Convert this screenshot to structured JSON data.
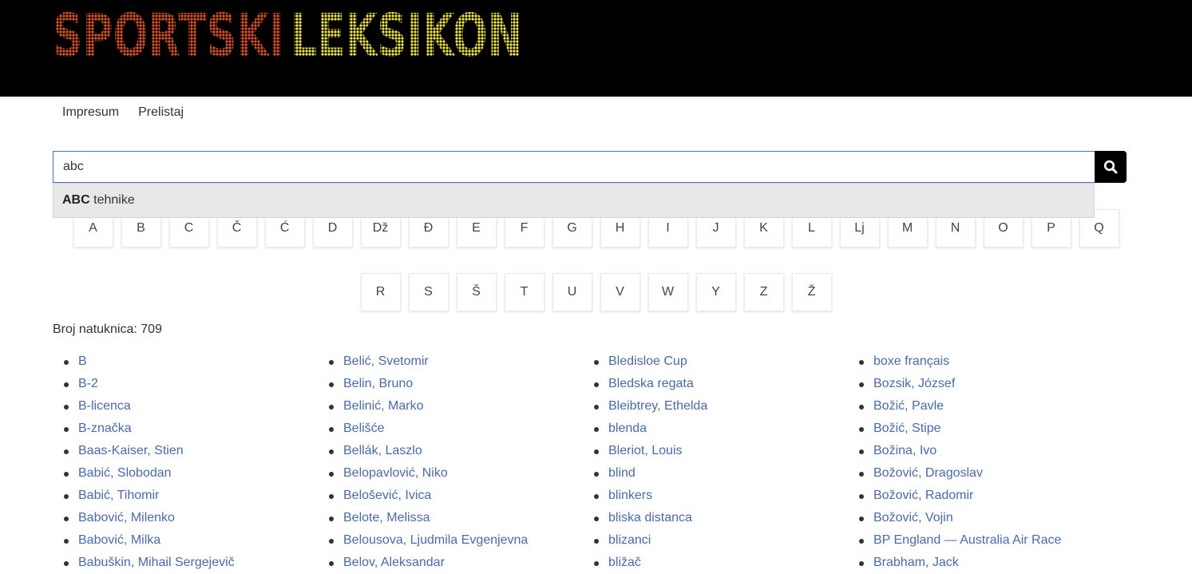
{
  "site": {
    "logo_text": "SPORTSKI LEKSIKON",
    "logo_part1": "SPORTSKI",
    "logo_part2": "LEKSIKON"
  },
  "nav": {
    "items": [
      "Impresum",
      "Prelistaj"
    ]
  },
  "search": {
    "value": "abc",
    "button_icon": "search-icon"
  },
  "autocomplete": {
    "match": "ABC",
    "rest": " tehnike"
  },
  "alphabet": {
    "row1": [
      "A",
      "B",
      "C",
      "Č",
      "Ć",
      "D",
      "Dž",
      "Đ",
      "E",
      "F",
      "G",
      "H",
      "I",
      "J",
      "K",
      "L",
      "Lj",
      "M",
      "N",
      "O",
      "P",
      "Q"
    ],
    "row2": [
      "R",
      "S",
      "Š",
      "T",
      "U",
      "V",
      "W",
      "Y",
      "Z",
      "Ž"
    ]
  },
  "results": {
    "count_label": "Broj natuknica: 709",
    "columns": [
      [
        "B",
        "B-2",
        "B-licenca",
        "B-značka",
        "Baas-Kaiser, Stien",
        "Babić, Slobodan",
        "Babić, Tihomir",
        "Babović, Milenko",
        "Babović, Milka",
        "Babuškin, Mihail Sergejevič"
      ],
      [
        "Belić, Svetomir",
        "Belin, Bruno",
        "Belinić, Marko",
        "Belišće",
        "Bellák, Laszlo",
        "Belopavlović, Niko",
        "Belošević, Ivica",
        "Belote, Melissa",
        "Belousova, Ljudmila Evgenjevna",
        "Belov, Aleksandar"
      ],
      [
        "Bledisloe Cup",
        "Bledska regata",
        "Bleibtrey, Ethelda",
        "blenda",
        "Bleriot, Louis",
        "blind",
        "blinkers",
        "bliska distanca",
        "blizanci",
        "bližač"
      ],
      [
        "boxe français",
        "Bozsik, József",
        "Božić, Pavle",
        "Božić, Stipe",
        "Božina, Ivo",
        "Božović, Dragoslav",
        "Božović, Radomir",
        "Božović, Vojin",
        "BP England — Australia Air Race",
        "Brabham, Jack"
      ]
    ]
  },
  "colors": {
    "header_bg": "#000000",
    "link": "#4a6aa8",
    "logo_red": "#e0542a",
    "logo_yellow": "#f2e84a"
  }
}
